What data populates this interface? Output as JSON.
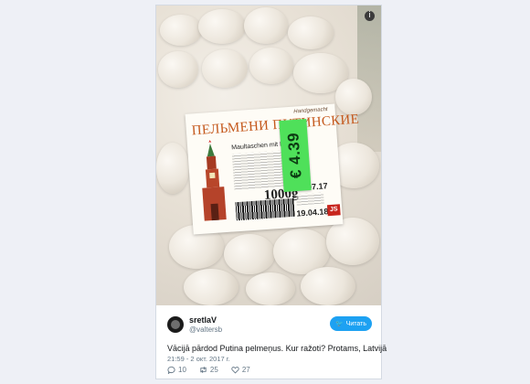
{
  "photo": {
    "label": {
      "handmade": "Handgemacht",
      "title": "ПЕЛЬМЕНИ ПУТИНСКИЕ",
      "subtitle": "Maultaschen mit Fl",
      "weight": "1000g",
      "date_packed": "19.07.17",
      "date_best_before": "19.04.18",
      "brand": "JS"
    },
    "price_sticker": "€ 4.39"
  },
  "tweet": {
    "name": "sretlaV",
    "handle": "@valtersb",
    "follow_label": "Читать",
    "text": "Vācijā pārdod Putina pelmeņus. Kur ražoti? Protams, Latvijā",
    "timestamp": "21:59 - 2 окт. 2017 г.",
    "replies": "10",
    "retweets": "25",
    "likes": "27"
  }
}
